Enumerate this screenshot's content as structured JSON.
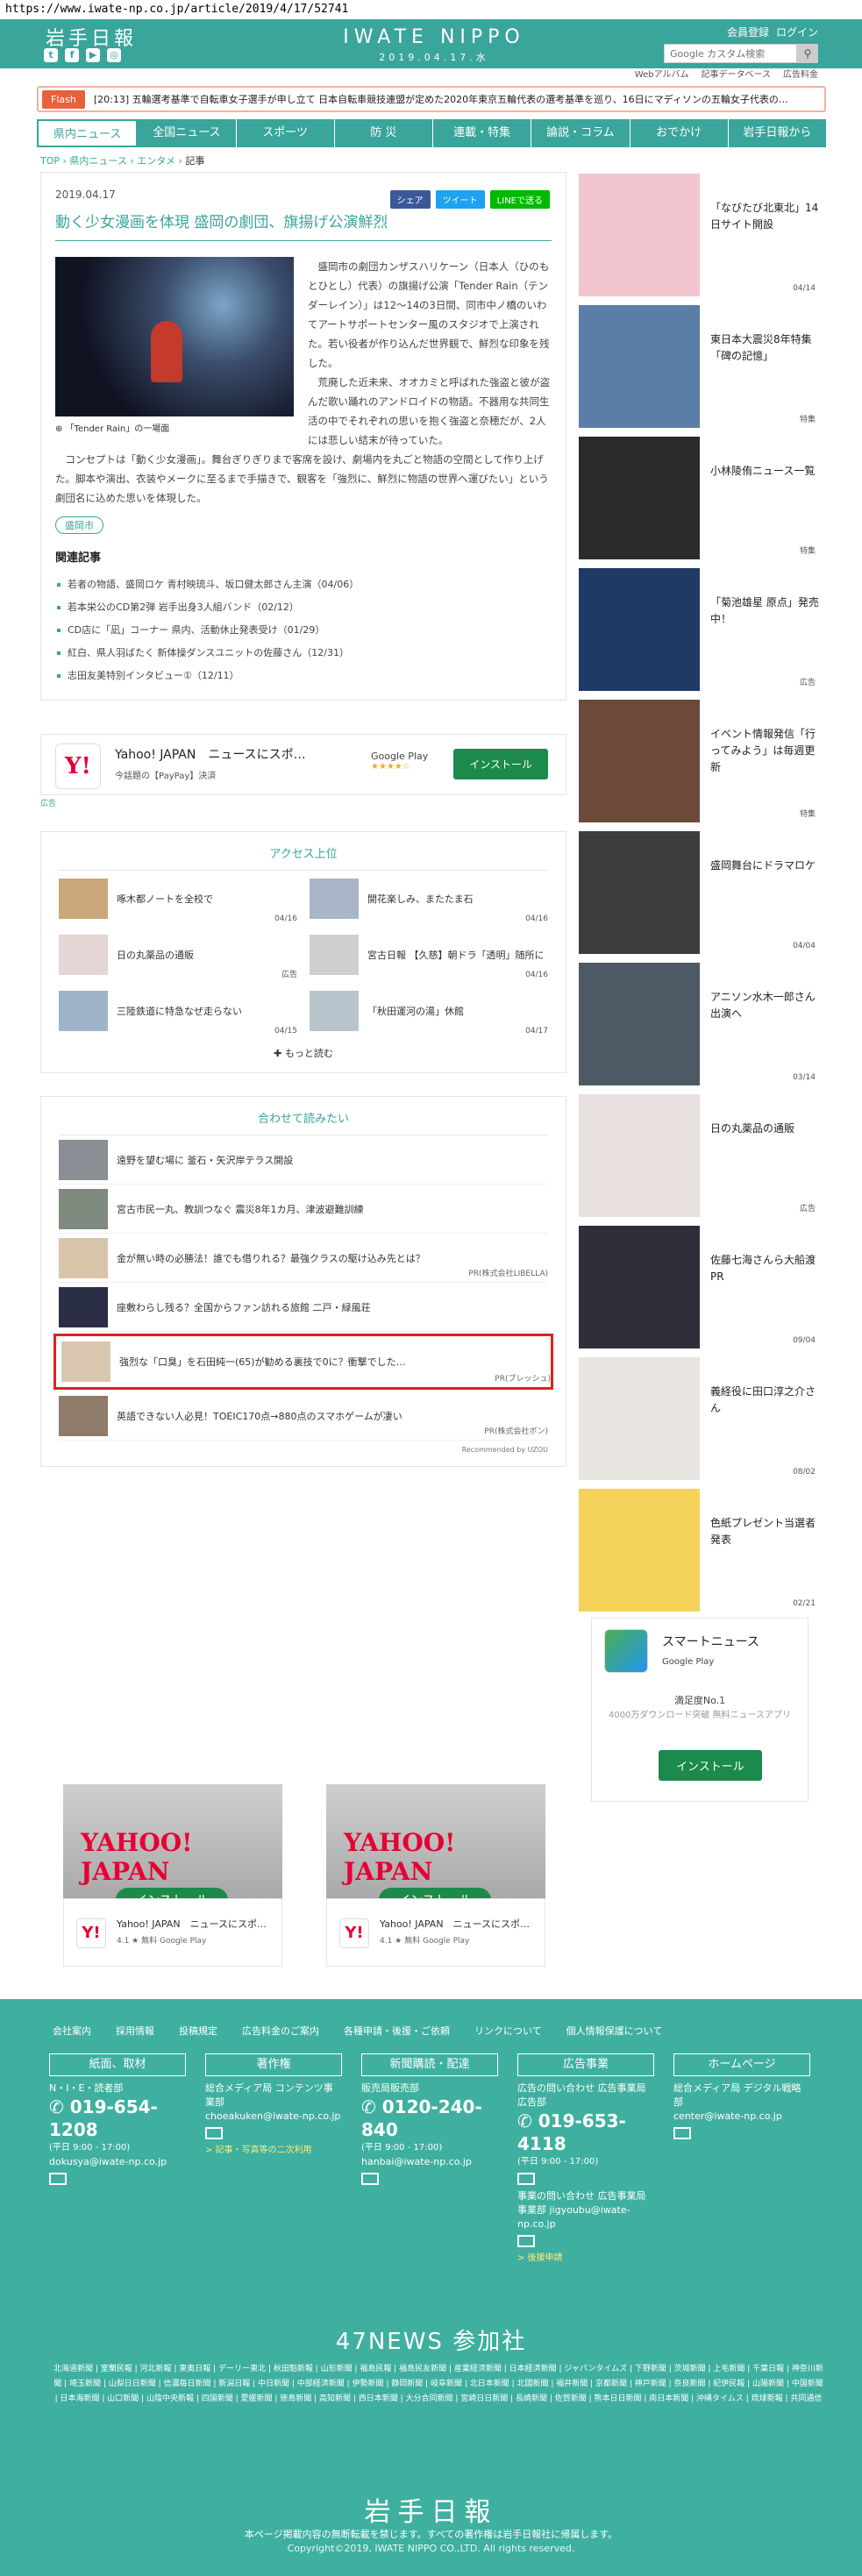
{
  "url": "https://www.iwate-np.co.jp/article/2019/4/17/52741",
  "header": {
    "logo_jp": "岩手日報",
    "logo_en": "IWATE NIPPO",
    "date": "2019.04.17.水",
    "links": [
      "会員登録",
      "ログイン"
    ],
    "search_placeholder": "Google カスタム検索",
    "subnav": [
      "Webアルバム",
      "記事データベース",
      "広告料金"
    ]
  },
  "flash": {
    "label": "Flash",
    "text": "[20:13] 五輪選考基準で自転車女子選手が申し立て 日本自転車競技連盟が定めた2020年東京五輪代表の選考基準を巡り、16日にマディソンの五輪女子代表の…"
  },
  "nav": [
    "県内ニュース",
    "全国ニュース",
    "スポーツ",
    "防 災",
    "連載・特集",
    "論説・コラム",
    "おでかけ",
    "岩手日報から"
  ],
  "breadcrumb": [
    "TOP",
    "県内ニュース",
    "エンタメ",
    "記事"
  ],
  "article": {
    "date": "2019.04.17",
    "share": [
      "シェア",
      "ツイート",
      "LINEで送る"
    ],
    "title": "動く少女漫画を体現 盛岡の劇団、旗揚げ公演鮮烈",
    "caption": "「Tender Rain」の一場面",
    "p1": "盛岡市の劇団カンザスハリケーン（日本人（ひのもとひとし）代表）の旗揚げ公演「Tender Rain（テンダーレイン）」は12～14の3日間、同市中ノ橋のいわてアートサポートセンター風のスタジオで上演された。若い役者が作り込んだ世界観で、鮮烈な印象を残した。",
    "p2": "荒廃した近未来、オオカミと呼ばれた強盗と彼が盗んだ歌い踊れのアンドロイドの物語。不器用な共同生活の中でそれぞれの思いを抱く強盗と奈穂だが、2人には悲しい結末が待っていた。",
    "p3": "コンセプトは「動く少女漫画」。舞台ぎりぎりまで客席を設け、劇場内を丸ごと物語の空間として作り上げた。脚本や演出、衣装やメークに至るまで手描きで、観客を「強烈に、鮮烈に物語の世界へ運びたい」という劇団名に込めた思いを体現した。",
    "tag": "盛岡市",
    "related_title": "関連記事",
    "related": [
      "若者の物語、盛岡ロケ 青村映琉斗、坂口健太郎さん主演（04/06）",
      "若本栄公のCD第2弾 岩手出身3人組バンド（02/12）",
      "CD店に「凪」コーナー 県内、活動休止発表受け（01/29）",
      "紅白、県人羽ばたく 新体操ダンスユニットの佐藤さん（12/31）",
      "志田友美特別インタビュー①（12/11）"
    ]
  },
  "ad_yahoo": {
    "name": "Yahoo! JAPAN　ニュースにスポ…",
    "sub": "今話題の【PayPay】決済",
    "store": "Google Play",
    "stars": "★★★★☆",
    "install": "インストール",
    "ad_tag": "広告"
  },
  "access": {
    "title": "アクセス上位",
    "items": [
      {
        "text": "啄木都ノートを全校で",
        "date": "04/16"
      },
      {
        "text": "開花楽しみ、またたま石",
        "date": "04/16"
      },
      {
        "text": "日の丸薬品の通販",
        "date": "広告"
      },
      {
        "text": "宮古日報 【久慈】朝ドラ「透明」随所に",
        "date": "04/16"
      },
      {
        "text": "三陸鉄道に特急なぜ走らない",
        "date": "04/15"
      },
      {
        "text": "「秋田運河の湯」休館",
        "date": "04/17"
      }
    ],
    "more": "もっと読む"
  },
  "read_more": {
    "title": "合わせて読みたい",
    "items": [
      {
        "text": "遠野を望む場に 釜石・矢沢岸テラス開設",
        "pr": ""
      },
      {
        "text": "宮古市民一丸、教訓つなぐ 震災8年1カ月、津波避難訓練",
        "pr": ""
      },
      {
        "text": "金が無い時の必勝法！誰でも借りれる？最強クラスの駆け込み先とは？",
        "pr": "PR(株式会社LIBELLA)"
      },
      {
        "text": "座敷わらし残る？全国からファン訪れる旅館 二戸・緑風荘",
        "pr": ""
      },
      {
        "text": "強烈な「口臭」を石田純一(65)が勧める裏技で0に？衝撃でした…",
        "pr": "PR(ブレッシュ)"
      },
      {
        "text": "英語できない人必見！TOEIC170点→880点のスマホゲームが凄い",
        "pr": "PR(株式会社ボン)"
      }
    ],
    "reco": "Recommended by UZOU"
  },
  "bottom_ads": [
    {
      "name": "Yahoo! JAPAN　ニュースにスポ…",
      "rating": "4.1 ★ 無料",
      "store": "Google Play",
      "install": "インストール",
      "brand": "YAHOO! JAPAN"
    },
    {
      "name": "Yahoo! JAPAN　ニュースにスポ…",
      "rating": "4.1 ★ 無料",
      "store": "Google Play",
      "install": "インストール",
      "brand": "YAHOO! JAPAN"
    }
  ],
  "sidebar": [
    {
      "title": "「なびたび北東北」14日サイト開設",
      "date": "04/14",
      "color": "#f3c6cf"
    },
    {
      "title": "東日本大震災8年特集「碑の記憶」",
      "date": "特集",
      "color": "#5a7ea8"
    },
    {
      "title": "小林陵侑ニュース一覧",
      "date": "特集",
      "color": "#2b2b2b"
    },
    {
      "title": "「菊池雄星 原点」発売中！",
      "date": "広告",
      "color": "#1f3a63"
    },
    {
      "title": "イベント情報発信「行ってみよう」は毎週更新",
      "date": "特集",
      "color": "#6b4a3a"
    },
    {
      "title": "盛岡舞台にドラマロケ",
      "date": "04/04",
      "color": "#3c3c3c"
    },
    {
      "title": "アニソン水木一郎さん出演へ",
      "date": "03/14",
      "color": "#4d5a66"
    },
    {
      "title": "日の丸薬品の通販",
      "date": "広告",
      "color": "#e9e0e0"
    },
    {
      "title": "佐藤七海さんら大船渡PR",
      "date": "09/04",
      "color": "#2f2f3a"
    },
    {
      "title": "義経役に田口淳之介さん",
      "date": "08/02",
      "color": "#e8e4e0"
    },
    {
      "title": "色紙プレゼント当選者発表",
      "date": "02/21",
      "color": "#f5d35b"
    }
  ],
  "smart": {
    "name": "スマートニュース",
    "store": "Google Play",
    "desc1": "満足度No.1",
    "desc2": "4000万ダウンロード突破 無料ニュースアプリ",
    "install": "インストール"
  },
  "footer": {
    "links": [
      "会社案内",
      "採用情報",
      "投稿規定",
      "広告料金のご案内",
      "各種申請・後援・ご依頼",
      "リンクについて",
      "個人情報保護について"
    ],
    "cols": [
      {
        "h": "紙面、取材",
        "l1": "N・I・E・読者部",
        "tel": "019-654-1208",
        "hours": "(平日 9:00 - 17:00)",
        "mail": "dokusya@iwate-np.co.jp",
        "extra": ""
      },
      {
        "h": "著作権",
        "l1": "総合メディア局 コンテンツ事業部",
        "tel": "",
        "hours": "",
        "mail": "choeakuken@iwate-np.co.jp",
        "extra": "> 記事・写真等の二次利用"
      },
      {
        "h": "新聞購読・配達",
        "l1": "販売局販売部",
        "tel": "0120-240-840",
        "hours": "(平日 9:00 - 17:00)",
        "mail": "hanbai@iwate-np.co.jp",
        "extra": ""
      },
      {
        "h": "広告事業",
        "l1": "広告の問い合わせ 広告事業局広告部",
        "tel": "019-653-4118",
        "hours": "(平日 9:00 - 17:00)",
        "mail": "事業の問い合わせ 広告事業局事業部 jigyoubu@iwate-np.co.jp",
        "extra": "> 後援申請"
      },
      {
        "h": "ホームページ",
        "l1": "総合メディア局 デジタル戦略部",
        "tel": "",
        "hours": "",
        "mail": "center@iwate-np.co.jp",
        "extra": ""
      }
    ],
    "n47": "47NEWS 参加社",
    "papers": "北海道新聞 | 室蘭民報 | 河北新報 | 東奥日報 | デーリー東北 | 秋田魁新報 | 山形新聞 | 福島民報 | 福島民友新聞 | 産業経済新聞 | 日本経済新聞 | ジャパンタイムズ | 下野新聞 | 茨城新聞 | 上毛新聞 | 千葉日報 | 神奈川新聞 | 埼玉新聞 | 山梨日日新聞 | 信濃毎日新聞 | 新潟日報 | 中日新聞 | 中部経済新聞 | 伊勢新聞 | 静岡新聞 | 岐阜新聞 | 北日本新聞 | 北國新聞 | 福井新聞 | 京都新聞 | 神戸新聞 | 奈良新聞 | 紀伊民報 | 山陽新聞 | 中国新聞 | 日本海新聞 | 山口新聞 | 山陰中央新報 | 四国新聞 | 愛媛新聞 | 徳島新聞 | 高知新聞 | 西日本新聞 | 大分合同新聞 | 宮崎日日新聞 | 長崎新聞 | 佐賀新聞 | 熊本日日新聞 | 南日本新聞 | 沖縄タイムス | 琉球新報 | 共同通信",
    "logo": "岩手日報",
    "note": "本ページ掲載内容の無断転載を禁じます。すべての著作権は岩手日報社に帰属します。",
    "copy": "Copyright©2019, IWATE NIPPO CO.,LTD. All rights reserved."
  }
}
